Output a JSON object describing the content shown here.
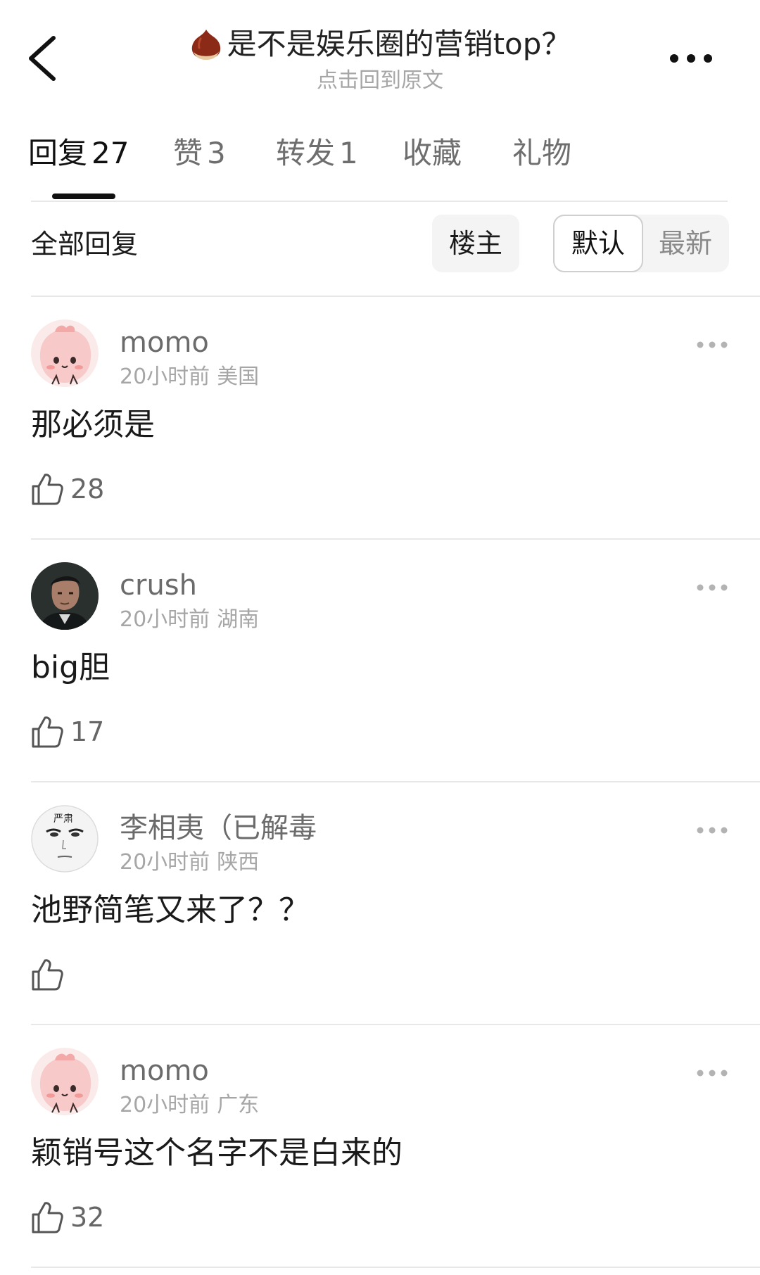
{
  "header": {
    "title": "是不是娱乐圈的营销top？",
    "subtitle": "点击回到原文"
  },
  "tabs": [
    {
      "label": "回复",
      "count": "27"
    },
    {
      "label": "赞",
      "count": "3"
    },
    {
      "label": "转发",
      "count": "1"
    },
    {
      "label": "收藏",
      "count": ""
    },
    {
      "label": "礼物",
      "count": ""
    }
  ],
  "filter": {
    "all_replies_label": "全部回复",
    "op_label": "楼主",
    "sort_default_label": "默认",
    "sort_latest_label": "最新"
  },
  "comments": [
    {
      "username": "momo",
      "time": "20小时前",
      "location": "美国",
      "text": "那必须是",
      "likes": "28",
      "avatar": "pink-bunny-avatar"
    },
    {
      "username": "crush",
      "time": "20小时前",
      "location": "湖南",
      "text": "big胆",
      "likes": "17",
      "avatar": "man-photo-avatar"
    },
    {
      "username": "李相夷（已解毒",
      "time": "20小时前",
      "location": "陕西",
      "text": "池野简笔又来了？？",
      "likes": "",
      "avatar": "sketch-face-avatar"
    },
    {
      "username": "momo",
      "time": "20小时前",
      "location": "广东",
      "text": "颖销号这个名字不是白来的",
      "likes": "32",
      "avatar": "pink-bunny-avatar"
    }
  ],
  "avatar_sketch_text": "严肃",
  "colors": {
    "text_primary": "#1a1a1a",
    "text_secondary": "#6b6b6b",
    "text_muted": "#a6a6a6",
    "divider": "#e8e8e8",
    "avatar_pink": "#f7c9c9"
  }
}
